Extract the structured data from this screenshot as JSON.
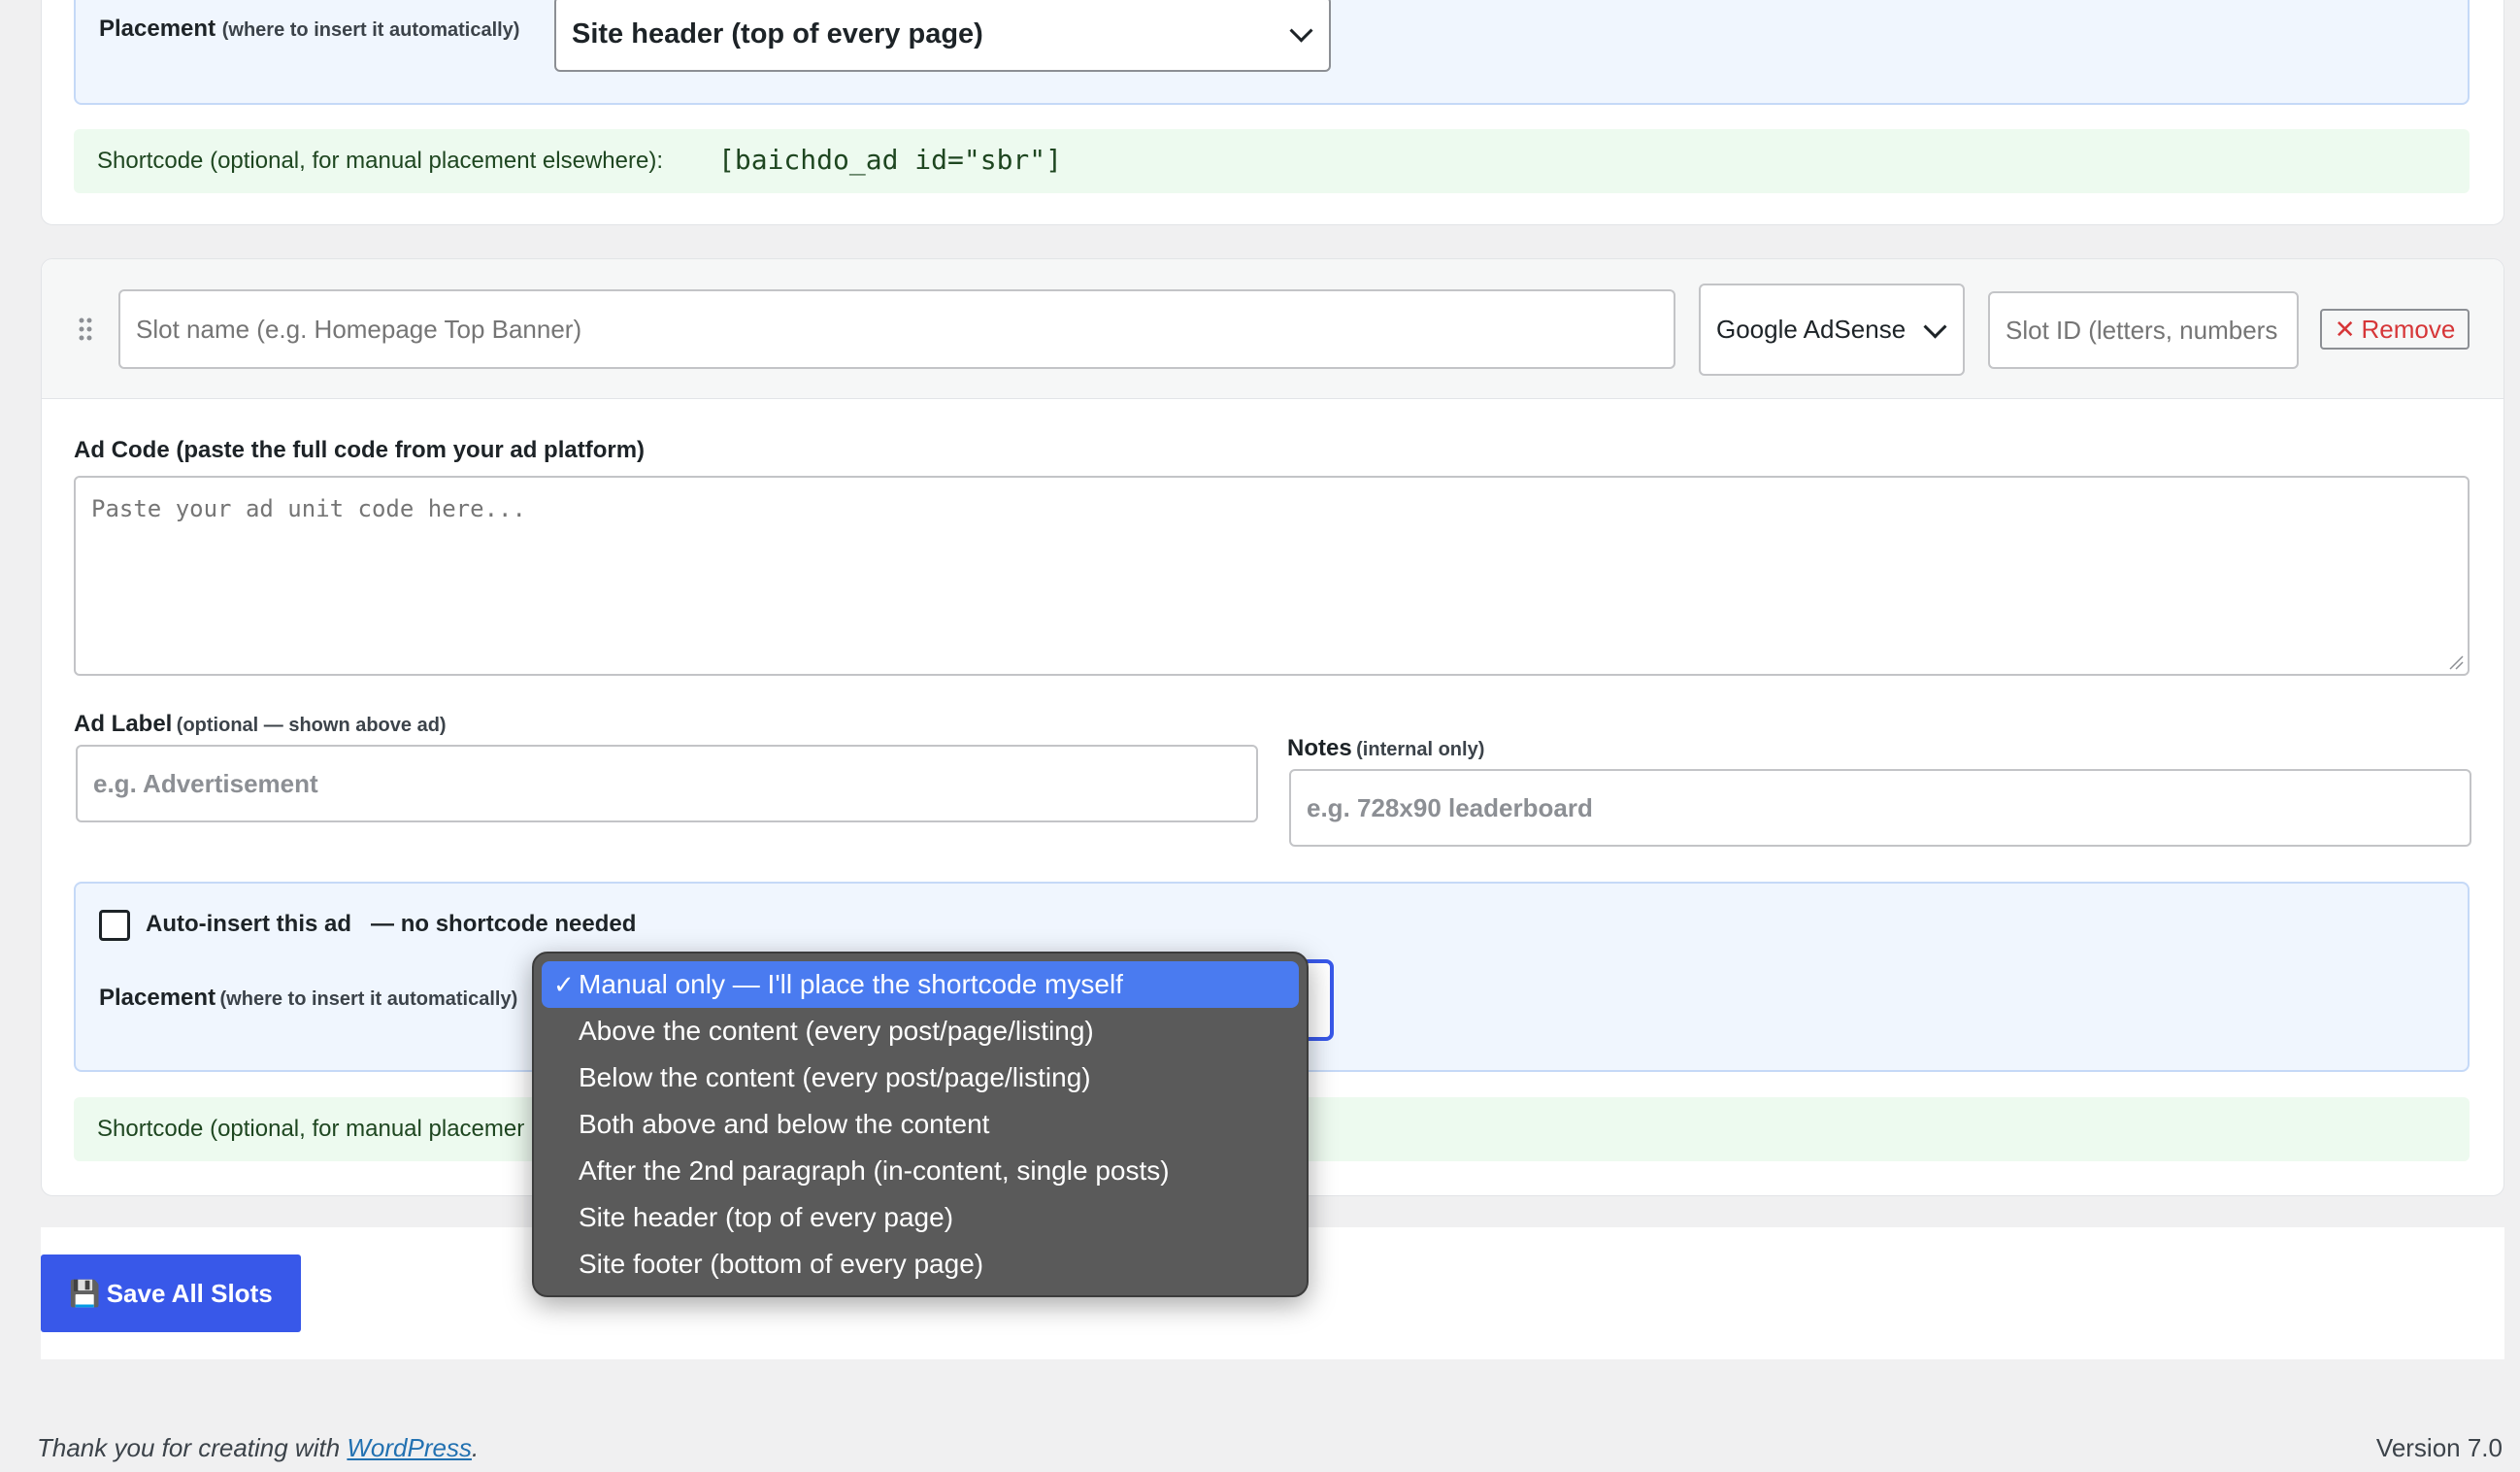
{
  "slot1": {
    "placement_label": "Placement",
    "placement_hint": "(where to insert it automatically)",
    "placement_value": "Site header (top of every page)",
    "shortcode_label": "Shortcode (optional, for manual placement elsewhere):",
    "shortcode_value": "[baichdo_ad id=\"sbr\"]"
  },
  "slot2": {
    "drag_icon": "drag-handle-icon",
    "slot_name_placeholder": "Slot name (e.g. Homepage Top Banner)",
    "network_value": "Google AdSense",
    "slot_id_placeholder": "Slot ID (letters, numbers",
    "remove_label": "Remove",
    "ad_code_label": "Ad Code (paste the full code from your ad platform)",
    "ad_code_placeholder": "Paste your ad unit code here...",
    "ad_label_label": "Ad Label",
    "ad_label_hint": "(optional — shown above ad)",
    "ad_label_placeholder": "e.g. Advertisement",
    "notes_label": "Notes",
    "notes_hint": "(internal only)",
    "notes_placeholder": "e.g. 728x90 leaderboard",
    "auto_insert_label": "Auto-insert this ad",
    "auto_insert_hint": "— no shortcode needed",
    "placement_label": "Placement",
    "placement_hint": "(where to insert it automatically)",
    "shortcode_label": "Shortcode (optional, for manual placement elsewhere):",
    "placement_options": [
      "Manual only — I'll place the shortcode myself",
      "Above the content (every post/page/listing)",
      "Below the content (every post/page/listing)",
      "Both above and below the content",
      "After the 2nd paragraph (in-content, single posts)",
      "Site header (top of every page)",
      "Site footer (bottom of every page)"
    ]
  },
  "save_button": {
    "icon": "floppy-disk-icon",
    "glyph": "💾",
    "label": "Save All Slots"
  },
  "footer": {
    "thanks_prefix": "Thank you for creating with ",
    "link": "WordPress",
    "suffix": ".",
    "version": "Version 7.0"
  },
  "colors": {
    "accent": "#3858e9",
    "remove": "#d63638",
    "green_text": "#1e4620",
    "selected_option": "#4a7bf0"
  }
}
